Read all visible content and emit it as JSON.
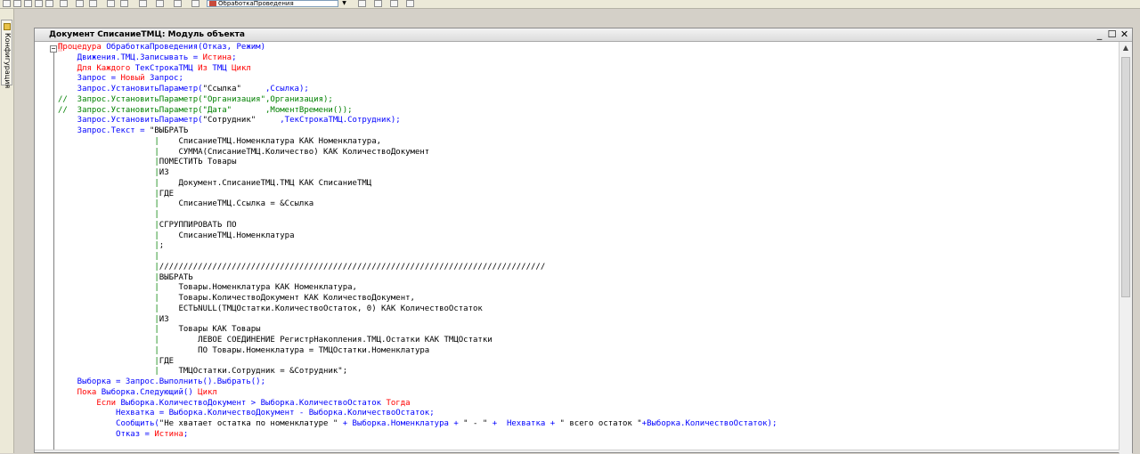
{
  "toolbar": {
    "combo_value": "ОбработкаПроведения",
    "combo_arrow": "▼"
  },
  "left_panel": {
    "tab_label": "Конфигурация"
  },
  "window": {
    "title": "Документ СписаниеТМЦ: Модуль объекта",
    "minimize": "_",
    "maximize": "☐",
    "close": "✕"
  },
  "editor": {
    "collapse_symbol": "−"
  },
  "code": [
    [
      {
        "t": "П",
        "c": "kw cursor"
      },
      {
        "t": "роцедура",
        "c": "kw"
      },
      {
        "t": " ОбработкаПроведения(Отказ, Режим)",
        "c": "id"
      }
    ],
    [
      {
        "t": "    Движения.ТМЦ.Записывать = ",
        "c": "id"
      },
      {
        "t": "Истина",
        "c": "kw"
      },
      {
        "t": ";",
        "c": "id"
      }
    ],
    [
      {
        "t": "    Для Каждого ",
        "c": "kw"
      },
      {
        "t": "ТекСтрокаТМЦ ",
        "c": "id"
      },
      {
        "t": "Из ",
        "c": "kw"
      },
      {
        "t": "ТМЦ ",
        "c": "id"
      },
      {
        "t": "Цикл",
        "c": "kw"
      }
    ],
    [
      {
        "t": "    Запрос = ",
        "c": "id"
      },
      {
        "t": "Новый ",
        "c": "kw"
      },
      {
        "t": "Запрос;",
        "c": "id"
      }
    ],
    [
      {
        "t": "    Запрос.УстановитьПараметр(",
        "c": "id"
      },
      {
        "t": "\"Ссылка\"     ",
        "c": "str"
      },
      {
        "t": ",Ссылка);",
        "c": "id"
      }
    ],
    [
      {
        "t": "//  Запрос.УстановитьПараметр(\"Организация\",Организация);",
        "c": "cmt"
      }
    ],
    [
      {
        "t": "//  Запрос.УстановитьПараметр(\"Дата\"       ,МоментВремени());",
        "c": "cmt"
      }
    ],
    [
      {
        "t": "    Запрос.УстановитьПараметр(",
        "c": "id"
      },
      {
        "t": "\"Сотрудник\"     ",
        "c": "str"
      },
      {
        "t": ",ТекСтрокаТМЦ.Сотрудник);",
        "c": "id"
      }
    ],
    [
      {
        "t": "    Запрос.Текст = ",
        "c": "id"
      },
      {
        "t": "\"ВЫБРАТЬ",
        "c": "str"
      }
    ],
    [
      {
        "t": "                    |",
        "c": "pipe"
      },
      {
        "t": "    СписаниеТМЦ.Номенклатура КАК Номенклатура,",
        "c": "str"
      }
    ],
    [
      {
        "t": "                    |",
        "c": "pipe"
      },
      {
        "t": "    СУММА(СписаниеТМЦ.Количество) КАК КоличествоДокумент",
        "c": "str"
      }
    ],
    [
      {
        "t": "                    |",
        "c": "pipe"
      },
      {
        "t": "ПОМЕСТИТЬ Товары",
        "c": "str"
      }
    ],
    [
      {
        "t": "                    |",
        "c": "pipe"
      },
      {
        "t": "ИЗ",
        "c": "str"
      }
    ],
    [
      {
        "t": "                    |",
        "c": "pipe"
      },
      {
        "t": "    Документ.СписаниеТМЦ.ТМЦ КАК СписаниеТМЦ",
        "c": "str"
      }
    ],
    [
      {
        "t": "                    |",
        "c": "pipe"
      },
      {
        "t": "ГДЕ",
        "c": "str"
      }
    ],
    [
      {
        "t": "                    |",
        "c": "pipe"
      },
      {
        "t": "    СписаниеТМЦ.Ссылка = &Ссылка",
        "c": "str"
      }
    ],
    [
      {
        "t": "                    |",
        "c": "pipe"
      }
    ],
    [
      {
        "t": "                    |",
        "c": "pipe"
      },
      {
        "t": "СГРУППИРОВАТЬ ПО",
        "c": "str"
      }
    ],
    [
      {
        "t": "                    |",
        "c": "pipe"
      },
      {
        "t": "    СписаниеТМЦ.Номенклатура",
        "c": "str"
      }
    ],
    [
      {
        "t": "                    |",
        "c": "pipe"
      },
      {
        "t": ";",
        "c": "str"
      }
    ],
    [
      {
        "t": "                    |",
        "c": "pipe"
      }
    ],
    [
      {
        "t": "                    |",
        "c": "pipe"
      },
      {
        "t": "////////////////////////////////////////////////////////////////////////////////",
        "c": "str"
      }
    ],
    [
      {
        "t": "                    |",
        "c": "pipe"
      },
      {
        "t": "ВЫБРАТЬ",
        "c": "str"
      }
    ],
    [
      {
        "t": "                    |",
        "c": "pipe"
      },
      {
        "t": "    Товары.Номенклатура КАК Номенклатура,",
        "c": "str"
      }
    ],
    [
      {
        "t": "                    |",
        "c": "pipe"
      },
      {
        "t": "    Товары.КоличествоДокумент КАК КоличествоДокумент,",
        "c": "str"
      }
    ],
    [
      {
        "t": "                    |",
        "c": "pipe"
      },
      {
        "t": "    ЕСТЬNULL(ТМЦОстатки.КоличествоОстаток, 0) КАК КоличествоОстаток",
        "c": "str"
      }
    ],
    [
      {
        "t": "                    |",
        "c": "pipe"
      },
      {
        "t": "ИЗ",
        "c": "str"
      }
    ],
    [
      {
        "t": "                    |",
        "c": "pipe"
      },
      {
        "t": "    Товары КАК Товары",
        "c": "str"
      }
    ],
    [
      {
        "t": "                    |",
        "c": "pipe"
      },
      {
        "t": "        ЛЕВОЕ СОЕДИНЕНИЕ РегистрНакопления.ТМЦ.Остатки КАК ТМЦОстатки",
        "c": "str"
      }
    ],
    [
      {
        "t": "                    |",
        "c": "pipe"
      },
      {
        "t": "        ПО Товары.Номенклатура = ТМЦОстатки.Номенклатура",
        "c": "str"
      }
    ],
    [
      {
        "t": "                    |",
        "c": "pipe"
      },
      {
        "t": "ГДЕ",
        "c": "str"
      }
    ],
    [
      {
        "t": "                    |",
        "c": "pipe"
      },
      {
        "t": "    ТМЦОстатки.Сотрудник = &Сотрудник\";",
        "c": "str"
      }
    ],
    [
      {
        "t": "    Выборка = Запрос.Выполнить().Выбрать();",
        "c": "id"
      }
    ],
    [
      {
        "t": "    Пока ",
        "c": "kw"
      },
      {
        "t": "Выборка.Следующий() ",
        "c": "id"
      },
      {
        "t": "Цикл",
        "c": "kw"
      }
    ],
    [
      {
        "t": "        Если ",
        "c": "kw"
      },
      {
        "t": "Выборка.КоличествоДокумент > Выборка.КоличествоОстаток ",
        "c": "id"
      },
      {
        "t": "Тогда",
        "c": "kw"
      }
    ],
    [
      {
        "t": "            Нехватка = Выборка.КоличествоДокумент - Выборка.КоличествоОстаток;",
        "c": "id"
      }
    ],
    [
      {
        "t": "            Сообщить(",
        "c": "id"
      },
      {
        "t": "\"Не хватает остатка по номенклатуре \" ",
        "c": "str"
      },
      {
        "t": "+ Выборка.Номенклатура + ",
        "c": "id"
      },
      {
        "t": "\" - \" ",
        "c": "str"
      },
      {
        "t": "+  Нехватка + ",
        "c": "id"
      },
      {
        "t": "\" всего остаток \"",
        "c": "str"
      },
      {
        "t": "+Выборка.КоличествоОстаток);",
        "c": "id"
      }
    ],
    [
      {
        "t": "            Отказ = ",
        "c": "id"
      },
      {
        "t": "Истина",
        "c": "kw"
      },
      {
        "t": ";",
        "c": "id"
      }
    ]
  ]
}
